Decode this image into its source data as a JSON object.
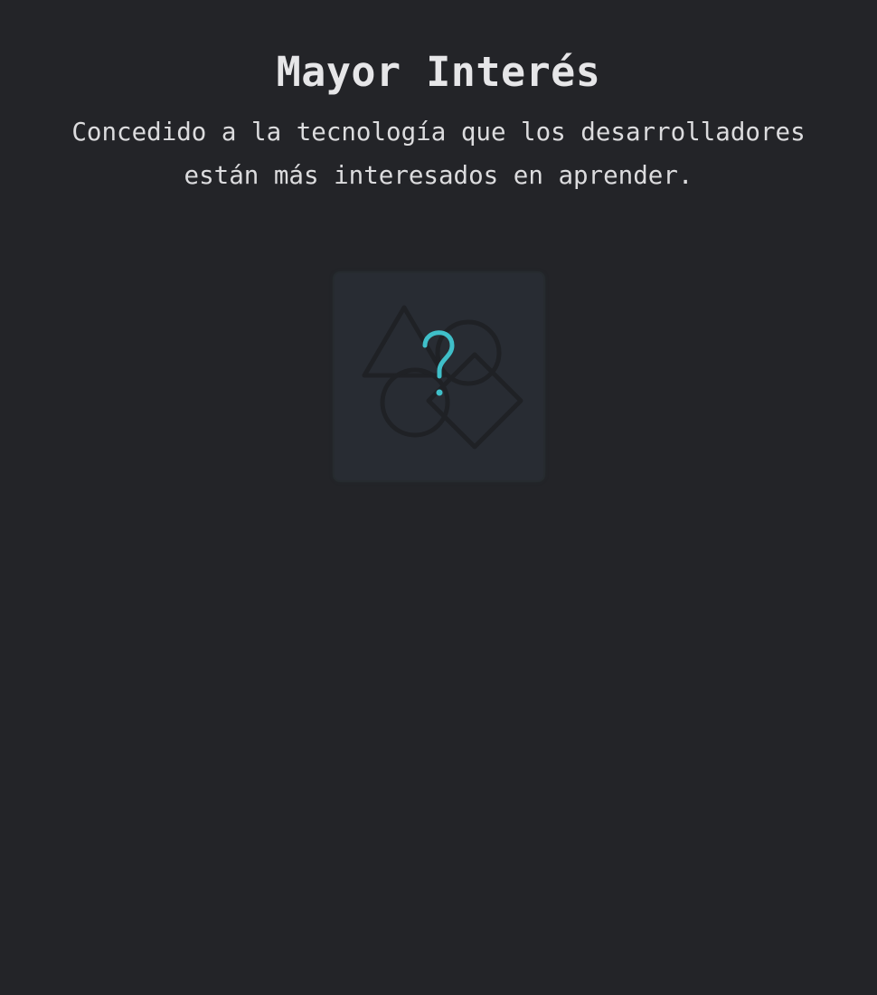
{
  "award": {
    "title": "Mayor Interés",
    "description": "Concedido a la tecnología que los desarrolladores están más interesados en aprender."
  },
  "placeholder": {
    "icon": "question-mark-shapes-icon",
    "glyph": "?",
    "accent_color": "#3fbfc9",
    "shape_color": "#1f2125"
  }
}
